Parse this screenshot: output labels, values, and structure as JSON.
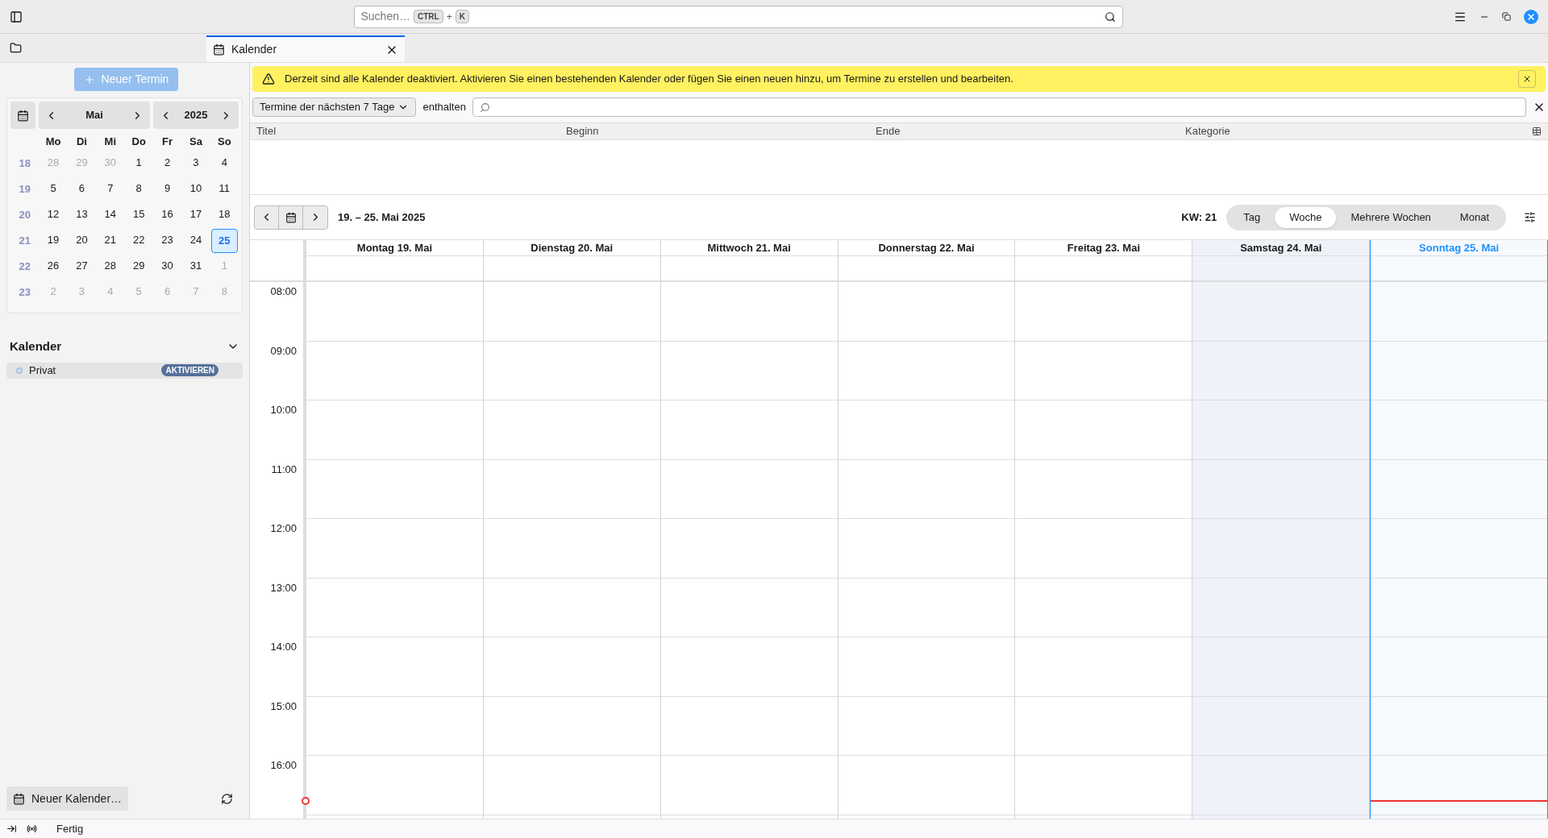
{
  "search": {
    "placeholder": "Suchen…",
    "keys": [
      "CTRL",
      "+",
      "K"
    ]
  },
  "tab": {
    "label": "Kalender",
    "selected": true
  },
  "sidebar": {
    "new_event": "Neuer Termin",
    "month": "Mai",
    "year": "2025",
    "weekdays": [
      "Mo",
      "Di",
      "Mi",
      "Do",
      "Fr",
      "Sa",
      "So"
    ],
    "weeks": [
      {
        "number": "18",
        "days": [
          {
            "label": "28",
            "outside": true,
            "selected": false
          },
          {
            "label": "29",
            "outside": true,
            "selected": false
          },
          {
            "label": "30",
            "outside": true,
            "selected": false
          },
          {
            "label": "1",
            "outside": false,
            "selected": false
          },
          {
            "label": "2",
            "outside": false,
            "selected": false
          },
          {
            "label": "3",
            "outside": false,
            "selected": false
          },
          {
            "label": "4",
            "outside": false,
            "selected": false
          }
        ]
      },
      {
        "number": "19",
        "days": [
          {
            "label": "5",
            "outside": false,
            "selected": false
          },
          {
            "label": "6",
            "outside": false,
            "selected": false
          },
          {
            "label": "7",
            "outside": false,
            "selected": false
          },
          {
            "label": "8",
            "outside": false,
            "selected": false
          },
          {
            "label": "9",
            "outside": false,
            "selected": false
          },
          {
            "label": "10",
            "outside": false,
            "selected": false
          },
          {
            "label": "11",
            "outside": false,
            "selected": false
          }
        ]
      },
      {
        "number": "20",
        "days": [
          {
            "label": "12",
            "outside": false,
            "selected": false
          },
          {
            "label": "13",
            "outside": false,
            "selected": false
          },
          {
            "label": "14",
            "outside": false,
            "selected": false
          },
          {
            "label": "15",
            "outside": false,
            "selected": false
          },
          {
            "label": "16",
            "outside": false,
            "selected": false
          },
          {
            "label": "17",
            "outside": false,
            "selected": false
          },
          {
            "label": "18",
            "outside": false,
            "selected": false
          }
        ]
      },
      {
        "number": "21",
        "days": [
          {
            "label": "19",
            "outside": false,
            "selected": false
          },
          {
            "label": "20",
            "outside": false,
            "selected": false
          },
          {
            "label": "21",
            "outside": false,
            "selected": false
          },
          {
            "label": "22",
            "outside": false,
            "selected": false
          },
          {
            "label": "23",
            "outside": false,
            "selected": false
          },
          {
            "label": "24",
            "outside": false,
            "selected": false
          },
          {
            "label": "25",
            "outside": false,
            "selected": true
          }
        ]
      },
      {
        "number": "22",
        "days": [
          {
            "label": "26",
            "outside": false,
            "selected": false
          },
          {
            "label": "27",
            "outside": false,
            "selected": false
          },
          {
            "label": "28",
            "outside": false,
            "selected": false
          },
          {
            "label": "29",
            "outside": false,
            "selected": false
          },
          {
            "label": "30",
            "outside": false,
            "selected": false
          },
          {
            "label": "31",
            "outside": false,
            "selected": false
          },
          {
            "label": "1",
            "outside": true,
            "selected": false
          }
        ]
      },
      {
        "number": "23",
        "days": [
          {
            "label": "2",
            "outside": true,
            "selected": false
          },
          {
            "label": "3",
            "outside": true,
            "selected": false
          },
          {
            "label": "4",
            "outside": true,
            "selected": false
          },
          {
            "label": "5",
            "outside": true,
            "selected": false
          },
          {
            "label": "6",
            "outside": true,
            "selected": false
          },
          {
            "label": "7",
            "outside": true,
            "selected": false
          },
          {
            "label": "8",
            "outside": true,
            "selected": false
          }
        ]
      }
    ],
    "calendars_heading": "Kalender",
    "calendars": [
      {
        "name": "Privat",
        "badge": "AKTIVIEREN",
        "enabled": false
      }
    ],
    "new_calendar": "Neuer Kalender…"
  },
  "notification": "Derzeit sind alle Kalender deaktiviert. Aktivieren Sie einen bestehenden Kalender oder fügen Sie einen neuen hinzu, um Termine zu erstellen und bearbeiten.",
  "filter": {
    "range": "Termine der nächsten 7 Tage",
    "contains": "enthalten"
  },
  "table": {
    "columns": [
      "Titel",
      "Beginn",
      "Ende",
      "Kategorie"
    ]
  },
  "week": {
    "range": "19. – 25. Mai 2025",
    "week_number": "KW: 21",
    "views": [
      {
        "label": "Tag",
        "selected": false
      },
      {
        "label": "Woche",
        "selected": true
      },
      {
        "label": "Mehrere Wochen",
        "selected": false
      },
      {
        "label": "Monat",
        "selected": false
      }
    ],
    "days": [
      {
        "label": "Montag 19. Mai",
        "weekend": false,
        "today": false
      },
      {
        "label": "Dienstag 20. Mai",
        "weekend": false,
        "today": false
      },
      {
        "label": "Mittwoch 21. Mai",
        "weekend": false,
        "today": false
      },
      {
        "label": "Donnerstag 22. Mai",
        "weekend": false,
        "today": false
      },
      {
        "label": "Freitag 23. Mai",
        "weekend": false,
        "today": false
      },
      {
        "label": "Samstag 24. Mai",
        "weekend": true,
        "today": false
      },
      {
        "label": "Sonntag 25. Mai",
        "weekend": false,
        "today": true
      }
    ],
    "hours": [
      "08:00",
      "09:00",
      "10:00",
      "11:00",
      "12:00",
      "13:00",
      "14:00",
      "15:00",
      "16:00"
    ]
  },
  "status": "Fertig"
}
